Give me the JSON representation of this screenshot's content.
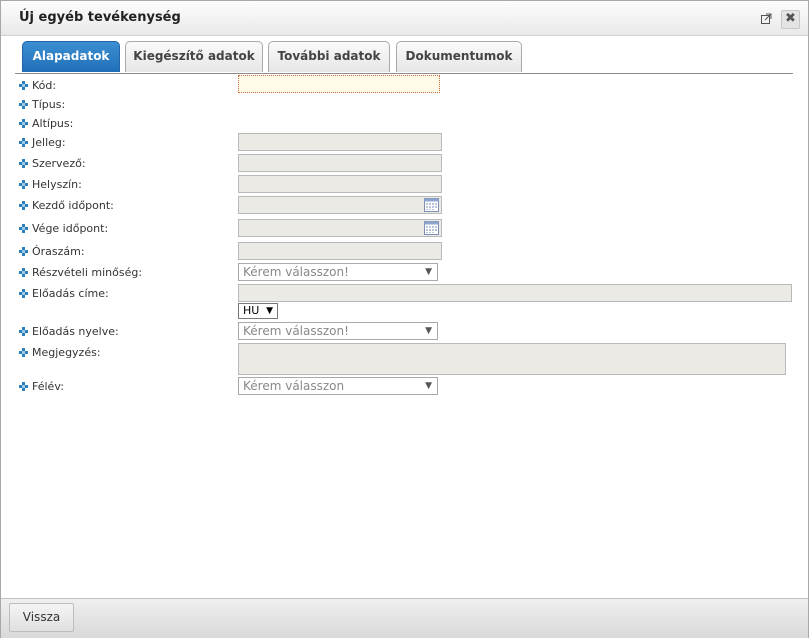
{
  "dialog": {
    "title": "Új egyéb tevékenység"
  },
  "tabs": [
    {
      "label": "Alapadatok",
      "active": true
    },
    {
      "label": "Kiegészítő adatok",
      "active": false
    },
    {
      "label": "További adatok",
      "active": false
    },
    {
      "label": "Dokumentumok",
      "active": false
    }
  ],
  "form": {
    "kod": {
      "label": "Kód:",
      "value": ""
    },
    "tipus": {
      "label": "Típus:"
    },
    "altipus": {
      "label": "Altípus:"
    },
    "jelleg": {
      "label": "Jelleg:",
      "value": ""
    },
    "szervezo": {
      "label": "Szervező:",
      "value": ""
    },
    "helyszin": {
      "label": "Helyszín:",
      "value": ""
    },
    "kezdo": {
      "label": "Kezdő időpont:",
      "value": ""
    },
    "vege": {
      "label": "Vége időpont:",
      "value": ""
    },
    "oraszam": {
      "label": "Óraszám:",
      "value": ""
    },
    "reszveteli": {
      "label": "Részvételi minőség:",
      "selected": "Kérem válasszon!"
    },
    "eloadas_cime": {
      "label": "Előadás címe:",
      "value": "",
      "lang": "HU"
    },
    "eloadas_nyelve": {
      "label": "Előadás nyelve:",
      "selected": "Kérem válasszon!"
    },
    "megjegyzes": {
      "label": "Megjegyzés:",
      "value": ""
    },
    "felev": {
      "label": "Félév:",
      "selected": "Kérem válasszon"
    }
  },
  "footer": {
    "back_label": "Vissza"
  }
}
